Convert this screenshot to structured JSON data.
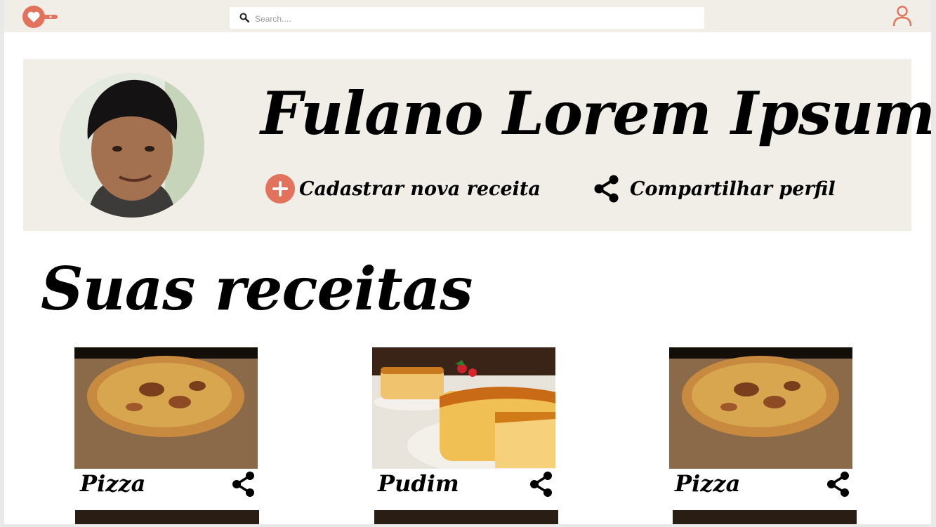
{
  "colors": {
    "accent": "#e2725b",
    "header_bg": "#f1eee8",
    "page_bg": "#ffffff"
  },
  "header": {
    "logo_icon": "heart-pan-icon",
    "search": {
      "placeholder": "Search....",
      "value": ""
    },
    "user_icon": "user-icon"
  },
  "profile": {
    "name": "Fulano Lorem Ipsum",
    "actions": {
      "new_recipe_label": "Cadastrar nova receita",
      "new_recipe_icon": "plus-circle-icon",
      "share_profile_label": "Compartilhar perfil",
      "share_profile_icon": "share-icon"
    }
  },
  "recipes": {
    "title": "Suas receitas",
    "cards": [
      {
        "title": "Pizza",
        "image": "pizza-photo",
        "share_icon": "share-icon"
      },
      {
        "title": "Pudim",
        "image": "pudim-photo",
        "share_icon": "share-icon"
      },
      {
        "title": "Pizza",
        "image": "pizza-photo",
        "share_icon": "share-icon"
      }
    ]
  }
}
